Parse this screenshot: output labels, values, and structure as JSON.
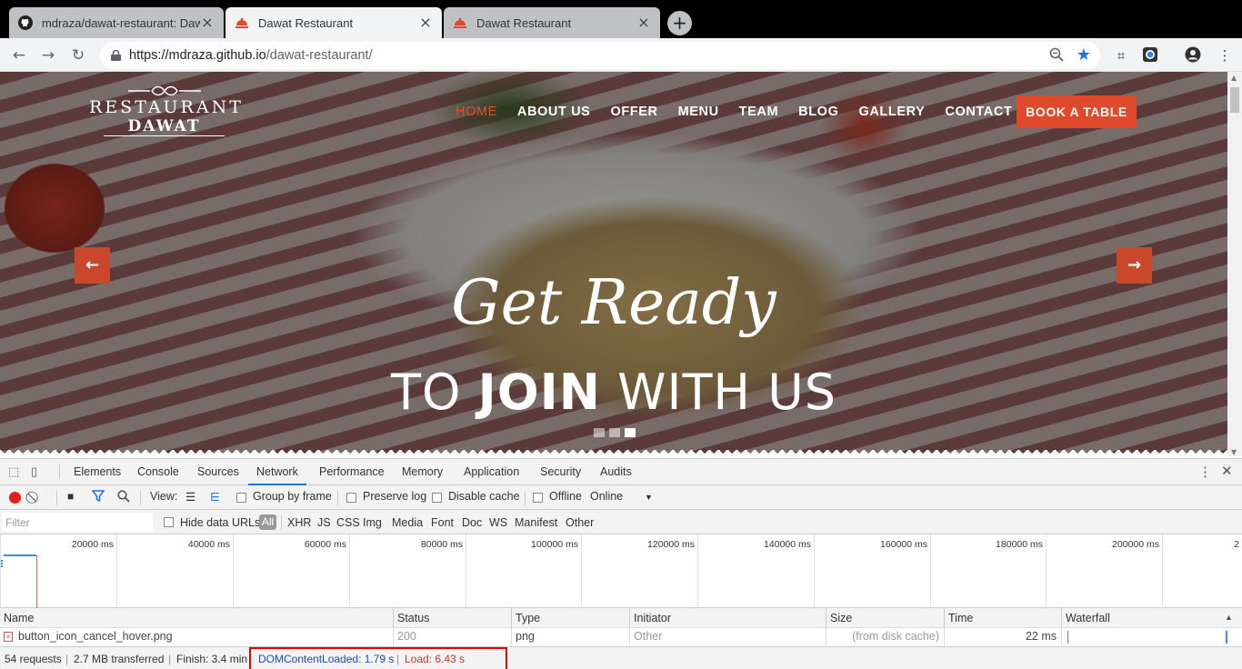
{
  "browser": {
    "tabs": [
      {
        "title": "mdraza/dawat-restaurant: Dawat Restaurant",
        "icon": "github-icon",
        "active": false
      },
      {
        "title": "Dawat Restaurant",
        "icon": "restaurant-favicon",
        "active": true
      },
      {
        "title": "Dawat Restaurant",
        "icon": "restaurant-favicon",
        "active": false
      }
    ],
    "new_tab": "+",
    "url_host": "https://mdraza.github.io",
    "url_path": "/dawat-restaurant/"
  },
  "site": {
    "logo_line1": "RESTAURANT",
    "logo_line2": "DAWAT",
    "nav": [
      "HOME",
      "ABOUT US",
      "OFFER",
      "MENU",
      "TEAM",
      "BLOG",
      "GALLERY",
      "CONTACT"
    ],
    "nav_active": "HOME",
    "book_button": "BOOK A TABLE",
    "headline1": "Get Ready",
    "headline2_pre": "TO ",
    "headline2_bold": "JOIN",
    "headline2_post": " WITH US",
    "slide_count": 3,
    "active_slide": 3,
    "accent_color": "#e04a2c"
  },
  "devtools": {
    "tabs": [
      "Elements",
      "Console",
      "Sources",
      "Network",
      "Performance",
      "Memory",
      "Application",
      "Security",
      "Audits"
    ],
    "active_tab": "Network",
    "toolbar": {
      "view_label": "View:",
      "group_by_frame": "Group by frame",
      "preserve_log": "Preserve log",
      "disable_cache": "Disable cache",
      "offline": "Offline",
      "throttle": "Online"
    },
    "filter": {
      "placeholder": "Filter",
      "hide_data_urls": "Hide data URLs",
      "types": [
        "All",
        "XHR",
        "JS",
        "CSS",
        "Img",
        "Media",
        "Font",
        "Doc",
        "WS",
        "Manifest",
        "Other"
      ]
    },
    "overview_ticks": [
      "20000 ms",
      "40000 ms",
      "60000 ms",
      "80000 ms",
      "100000 ms",
      "120000 ms",
      "140000 ms",
      "160000 ms",
      "180000 ms",
      "200000 ms",
      "2"
    ],
    "columns": [
      "Name",
      "Status",
      "Type",
      "Initiator",
      "Size",
      "Time",
      "Waterfall"
    ],
    "rows": [
      {
        "name": "button_icon_cancel_hover.png",
        "status": "200",
        "type": "png",
        "initiator": "Other",
        "size": "(from disk cache)",
        "time": "22 ms"
      }
    ],
    "summary": {
      "requests": "54 requests",
      "transferred": "2.7 MB transferred",
      "finish": "Finish: 3.4 min",
      "dom_content_loaded": "DOMContentLoaded: 1.79 s",
      "load": "Load: 6.43 s"
    }
  }
}
